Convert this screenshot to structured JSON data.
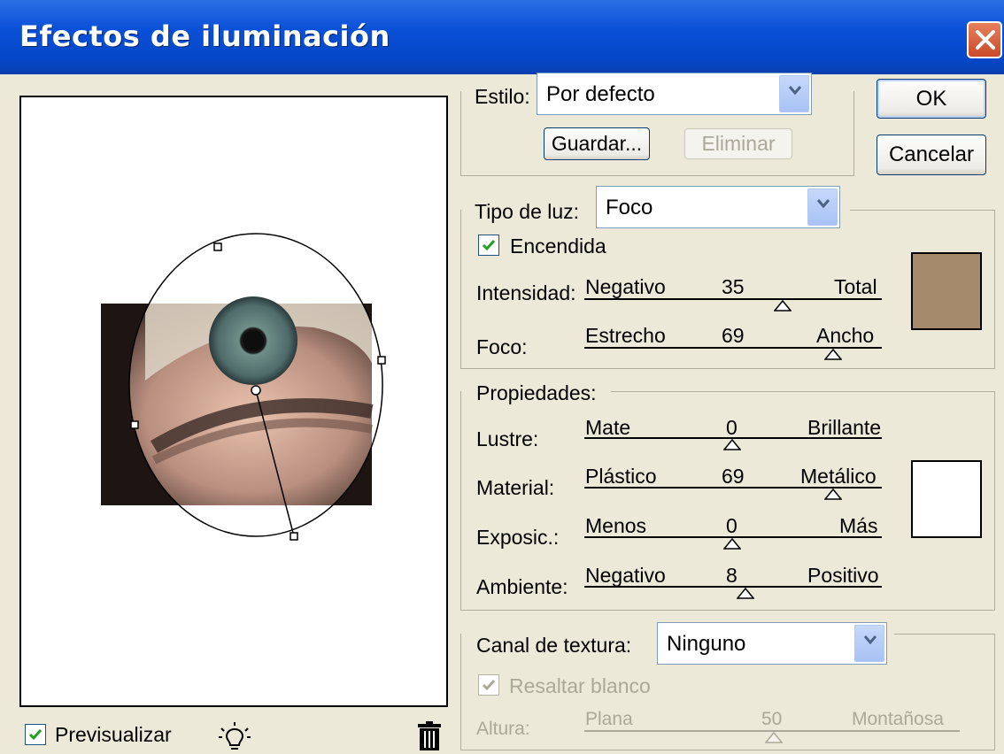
{
  "window": {
    "title": "Efectos de iluminación"
  },
  "preview": {
    "checkbox_label": "Previsualizar",
    "checked": true
  },
  "style": {
    "label": "Estilo:",
    "selected": "Por defecto",
    "save_label": "Guardar...",
    "delete_label": "Eliminar"
  },
  "buttons": {
    "ok": "OK",
    "cancel": "Cancelar"
  },
  "light": {
    "type_label": "Tipo de luz:",
    "type_selected": "Foco",
    "on_label": "Encendida",
    "on_checked": true,
    "color": "#a68a6c",
    "intensity": {
      "label": "Intensidad:",
      "min_label": "Negativo",
      "value": "35",
      "max_label": "Total"
    },
    "focus": {
      "label": "Foco:",
      "min_label": "Estrecho",
      "value": "69",
      "max_label": "Ancho"
    }
  },
  "properties": {
    "label": "Propiedades:",
    "color": "#ffffff",
    "gloss": {
      "label": "Lustre:",
      "min_label": "Mate",
      "value": "0",
      "max_label": "Brillante"
    },
    "material": {
      "label": "Material:",
      "min_label": "Plástico",
      "value": "69",
      "max_label": "Metálico"
    },
    "exposure": {
      "label": "Exposic.:",
      "min_label": "Menos",
      "value": "0",
      "max_label": "Más"
    },
    "ambience": {
      "label": "Ambiente:",
      "min_label": "Negativo",
      "value": "8",
      "max_label": "Positivo"
    }
  },
  "texture": {
    "channel_label": "Canal de textura:",
    "channel_selected": "Ninguno",
    "white_high_label": "Resaltar blanco",
    "white_high_checked": true,
    "height": {
      "label": "Altura:",
      "min_label": "Plana",
      "value": "50",
      "max_label": "Montañosa"
    }
  }
}
